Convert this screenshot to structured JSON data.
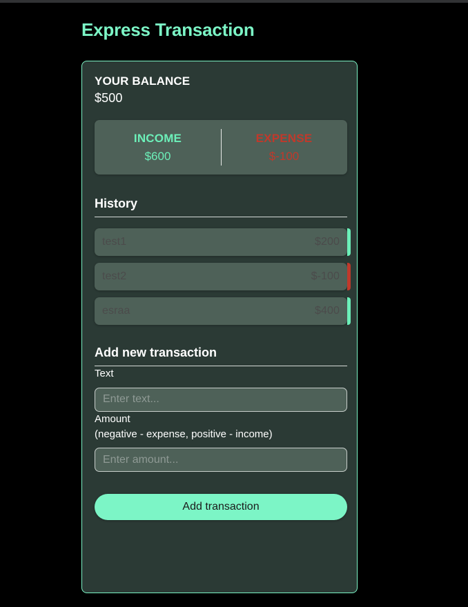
{
  "app": {
    "title": "Express Transaction"
  },
  "balance": {
    "heading": "YOUR BALANCE",
    "amount": "$500"
  },
  "summary": {
    "income_label": "INCOME",
    "income_value": "$600",
    "expense_label": "EXPENSE",
    "expense_value": "$-100"
  },
  "history": {
    "heading": "History",
    "items": [
      {
        "text": "test1",
        "amount": "$200",
        "type": "plus"
      },
      {
        "text": "test2",
        "amount": "$-100",
        "type": "minus"
      },
      {
        "text": "esraa",
        "amount": "$400",
        "type": "plus"
      }
    ]
  },
  "form": {
    "heading": "Add new transaction",
    "text_label": "Text",
    "text_placeholder": "Enter text...",
    "text_value": "",
    "amount_label_line1": "Amount",
    "amount_label_line2": "(negative - expense, positive - income)",
    "amount_placeholder": "Enter amount...",
    "amount_value": "",
    "submit_label": "Add transaction"
  },
  "colors": {
    "accent_mint": "#7cf5c6",
    "income_green": "#6cf0b9",
    "expense_red": "#c0392b",
    "card_bg": "#2b3a35",
    "field_bg": "#4e6158",
    "page_bg": "#000000"
  }
}
